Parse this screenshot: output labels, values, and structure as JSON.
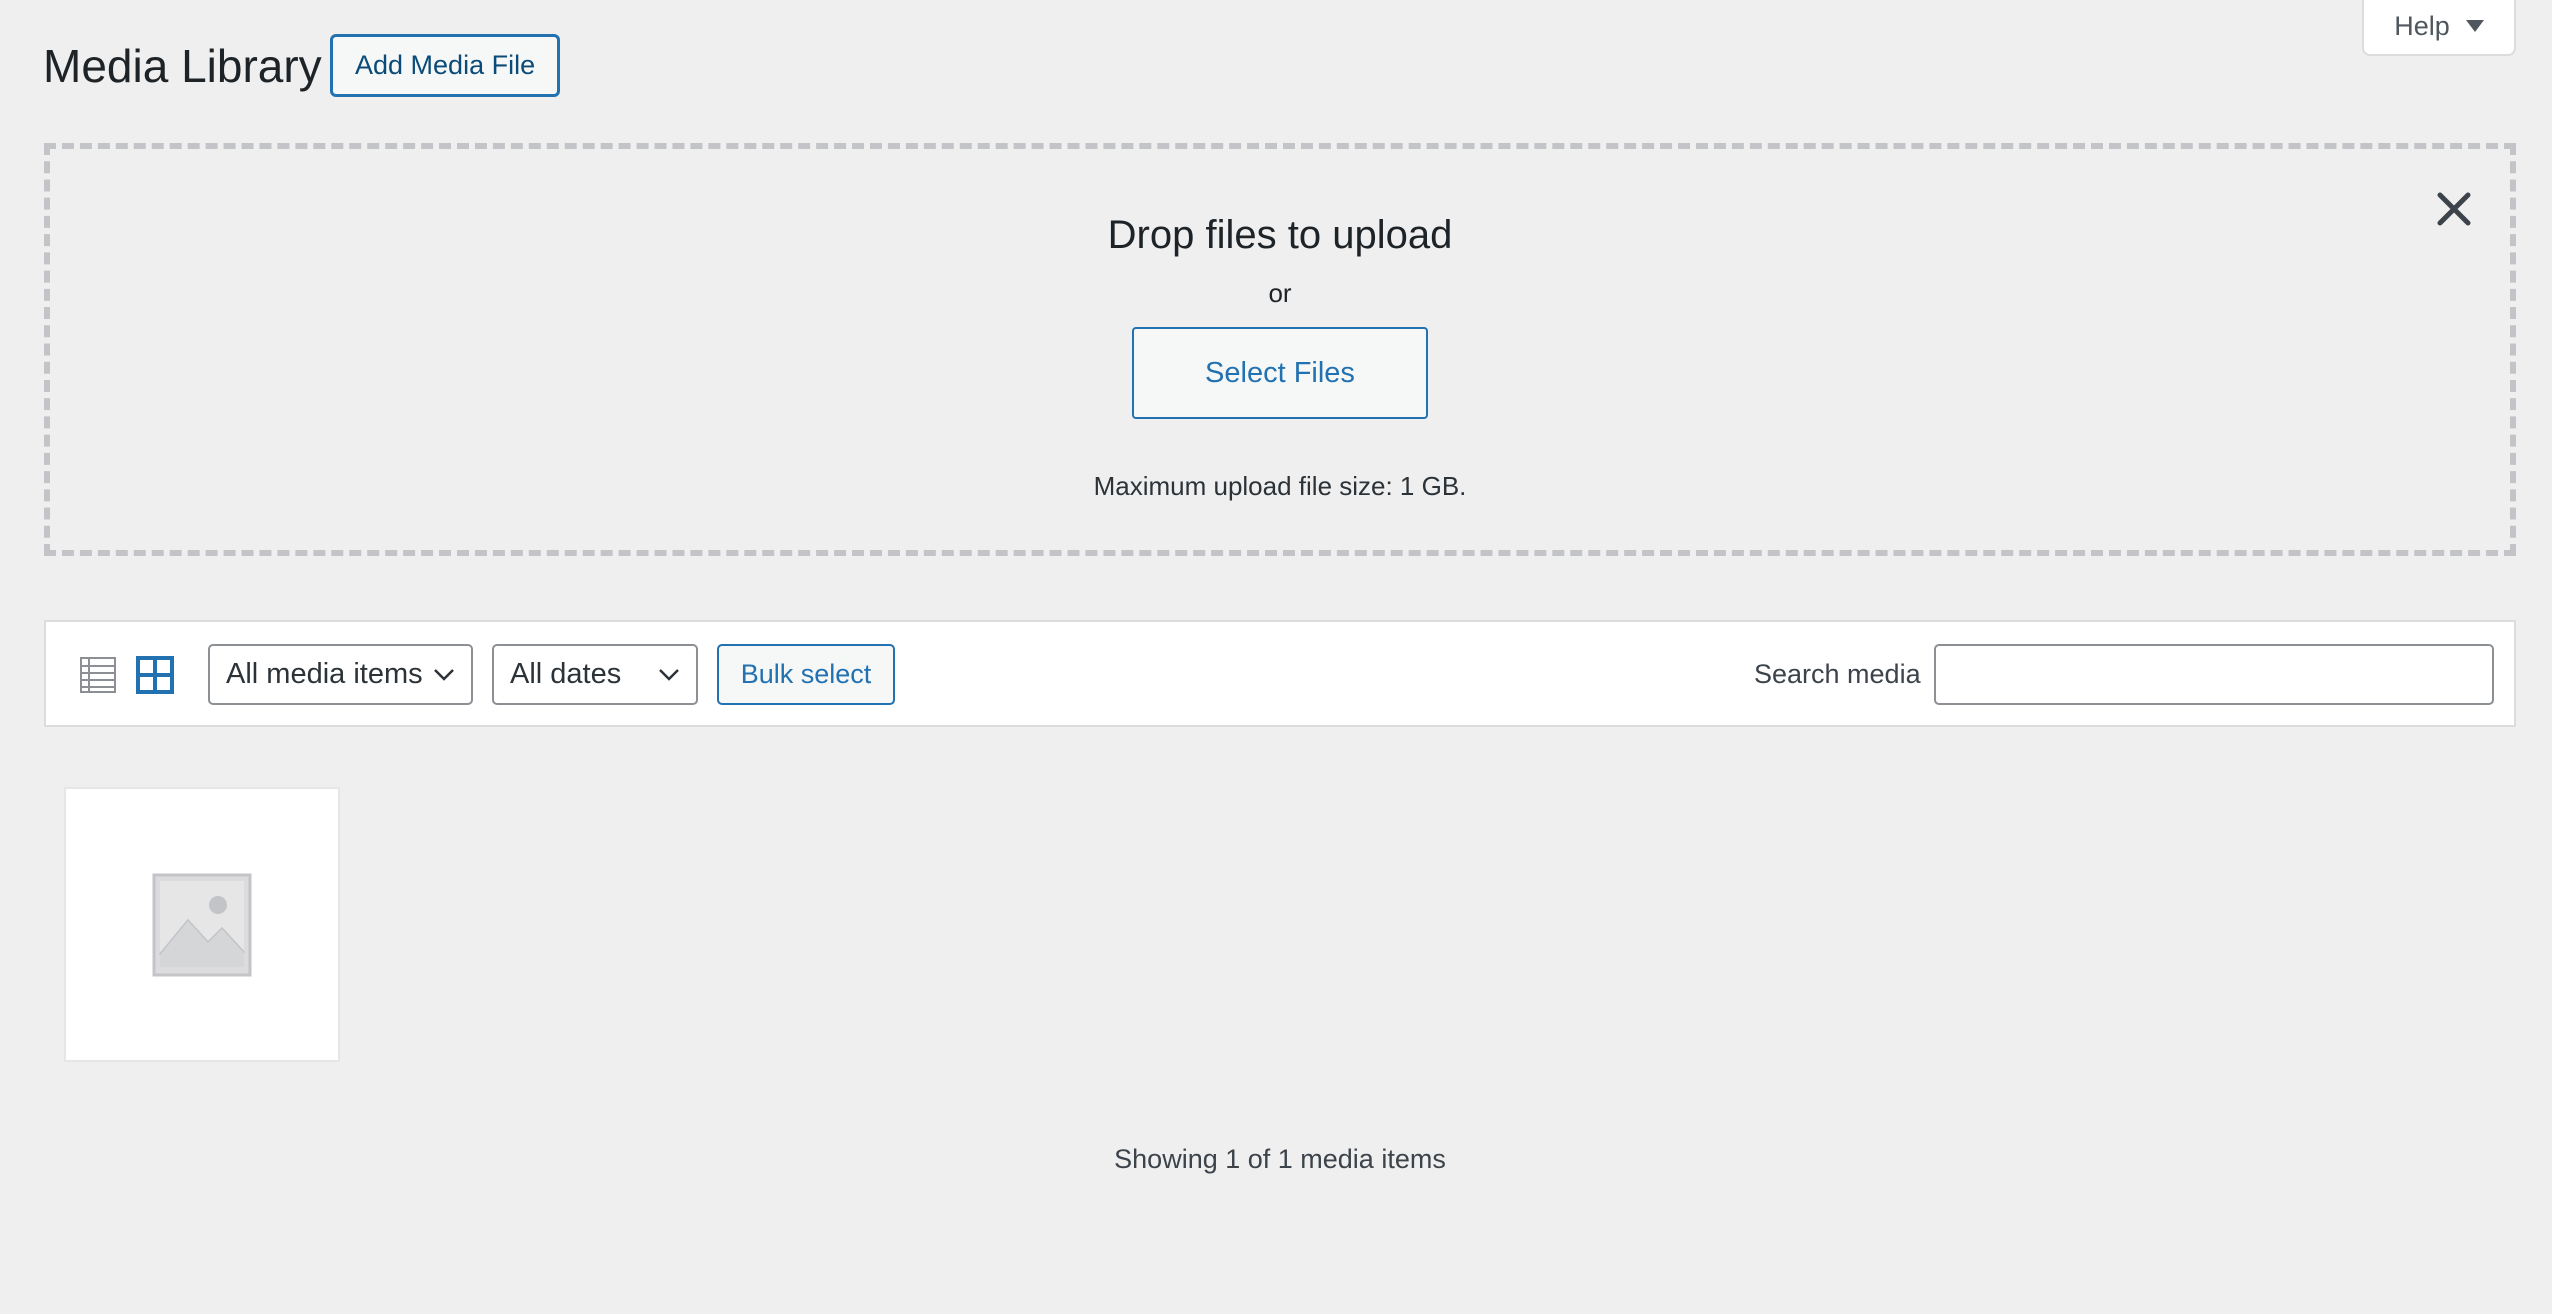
{
  "help": {
    "label": "Help"
  },
  "header": {
    "title": "Media Library",
    "add_button_label": "Add Media File"
  },
  "uploader": {
    "drop_title": "Drop files to upload",
    "or_text": "or",
    "select_button_label": "Select Files",
    "max_size_text": "Maximum upload file size: 1 GB."
  },
  "toolbar": {
    "views": [
      "list-view-icon",
      "grid-view-icon"
    ],
    "active_view": "grid",
    "type_filter": {
      "selected": "All media items"
    },
    "date_filter": {
      "selected": "All dates"
    },
    "bulk_select_label": "Bulk select",
    "search_label": "Search media",
    "search_value": ""
  },
  "attachments": [
    {
      "icon": "image-placeholder-icon"
    }
  ],
  "footer": {
    "count_text": "Showing 1 of 1 media items"
  },
  "colors": {
    "accent": "#2271b1",
    "background": "#efefef",
    "border": "#c3c4c7"
  }
}
